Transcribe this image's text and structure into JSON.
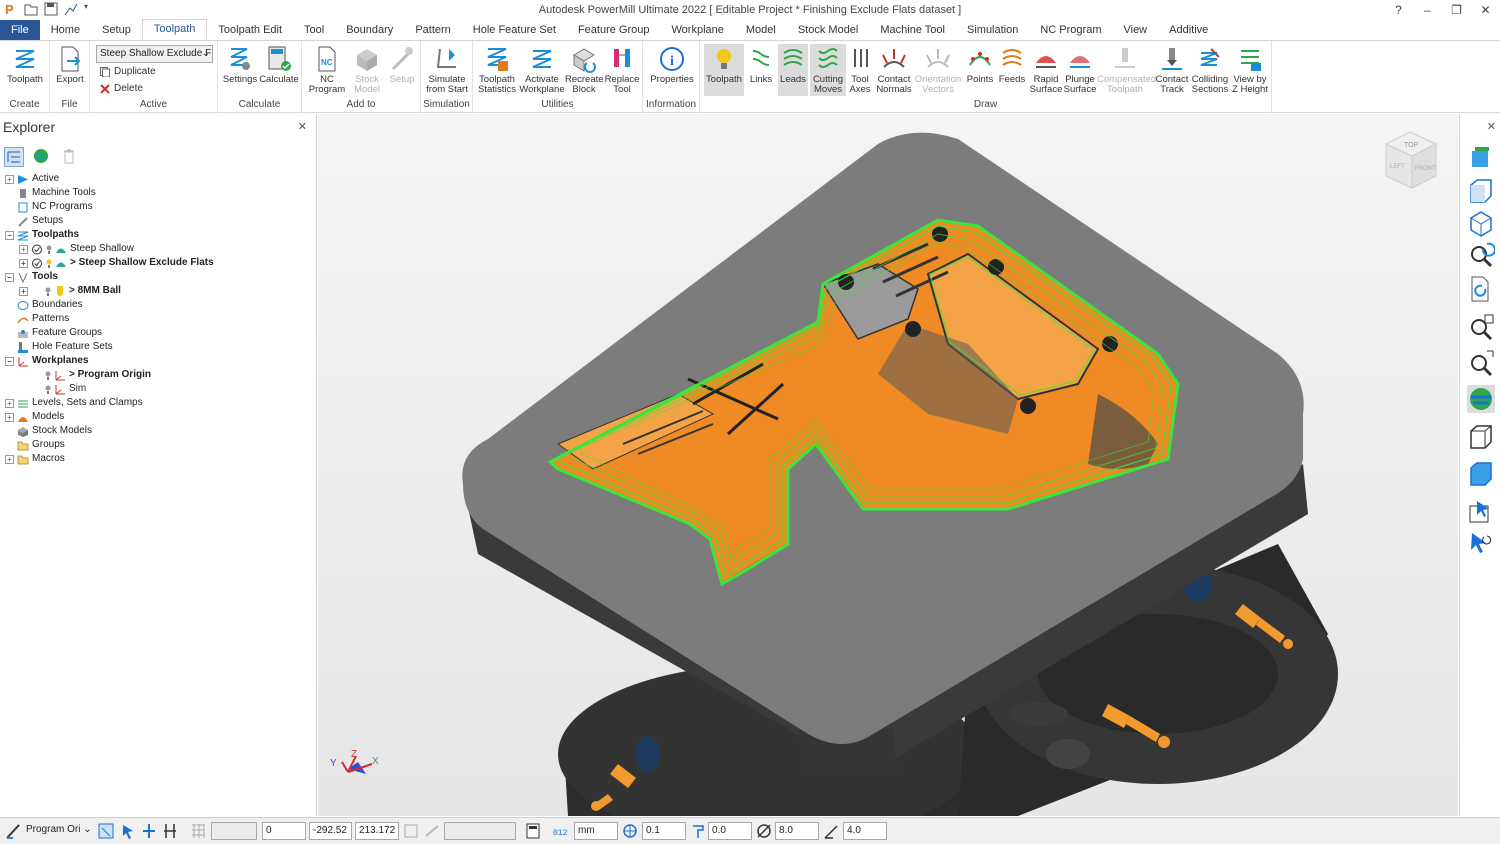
{
  "window": {
    "title": "Autodesk PowerMill Ultimate 2022    [ Editable Project * Finishing Exclude Flats dataset ]",
    "controls": [
      "?",
      "–",
      "❐",
      "✕"
    ]
  },
  "tabs": [
    "File",
    "Home",
    "Setup",
    "Toolpath",
    "Toolpath Edit",
    "Tool",
    "Boundary",
    "Pattern",
    "Hole Feature Set",
    "Feature Group",
    "Workplane",
    "Model",
    "Stock Model",
    "Machine Tool",
    "Simulation",
    "NC Program",
    "View",
    "Additive"
  ],
  "active_tab": "Toolpath",
  "ribbon": {
    "create": {
      "label": "Create",
      "toolpath": "Toolpath"
    },
    "file": {
      "label": "File",
      "export": "Export"
    },
    "active": {
      "label": "Active",
      "selected": "Steep Shallow Exclude F",
      "duplicate": "Duplicate",
      "delete": "Delete"
    },
    "calculate": {
      "label": "Calculate",
      "settings": "Settings",
      "calculate": "Calculate"
    },
    "addto": {
      "label": "Add to",
      "nc": "NC Program",
      "stock": "Stock Model",
      "setup": "Setup"
    },
    "simulation": {
      "label": "Simulation",
      "simulate": "Simulate from Start"
    },
    "utilities": {
      "label": "Utilities",
      "stats": "Toolpath Statistics",
      "activate": "Activate Workplane",
      "recreate": "Recreate Block",
      "replace": "Replace Tool"
    },
    "information": {
      "label": "Information",
      "properties": "Properties"
    },
    "draw": {
      "label": "Draw",
      "toolpath": "Toolpath",
      "links": "Links",
      "leads": "Leads",
      "cutting": "Cutting Moves",
      "toolaxes": "Tool Axes",
      "normals": "Contact Normals",
      "orient": "Orientation Vectors",
      "points": "Points",
      "feeds": "Feeds",
      "rapid": "Rapid Surface",
      "plunge": "Plunge Surface",
      "comp": "Compensated Toolpath",
      "track": "Contact Track",
      "colliding": "Colliding Sections",
      "zheight": "View by Z Height"
    }
  },
  "explorer": {
    "title": "Explorer",
    "items": [
      {
        "label": "Active"
      },
      {
        "label": "Machine Tools"
      },
      {
        "label": "NC Programs"
      },
      {
        "label": "Setups"
      },
      {
        "label": "Toolpaths"
      },
      {
        "label": "Steep Shallow"
      },
      {
        "label": "> Steep Shallow Exclude Flats"
      },
      {
        "label": "Tools"
      },
      {
        "label": "> 8MM Ball"
      },
      {
        "label": "Boundaries"
      },
      {
        "label": "Patterns"
      },
      {
        "label": "Feature Groups"
      },
      {
        "label": "Hole Feature Sets"
      },
      {
        "label": "Workplanes"
      },
      {
        "label": "> Program Origin"
      },
      {
        "label": "Sim"
      },
      {
        "label": "Levels, Sets and Clamps"
      },
      {
        "label": "Models"
      },
      {
        "label": "Stock Models"
      },
      {
        "label": "Groups"
      },
      {
        "label": "Macros"
      }
    ]
  },
  "viewport": {
    "viewcube": {
      "top": "TOP",
      "left": "LEFT",
      "front": "FRONT"
    },
    "triad": {
      "x": "X",
      "y": "Y",
      "z": "Z"
    },
    "colors": {
      "stock": "#7a7a7a",
      "part": "#f08a24",
      "toolpath": "#39e63b",
      "machine": "#2f2f2f",
      "fitting": "#f39a2e"
    }
  },
  "statusbar": {
    "workplane": "Program Ori",
    "f1": "0",
    "x": "-292.52",
    "y": "213.172",
    "units": "mm",
    "tolerance": "0.1",
    "thickness": "0.0",
    "diameter": "8.0",
    "stepover": "4.0"
  }
}
